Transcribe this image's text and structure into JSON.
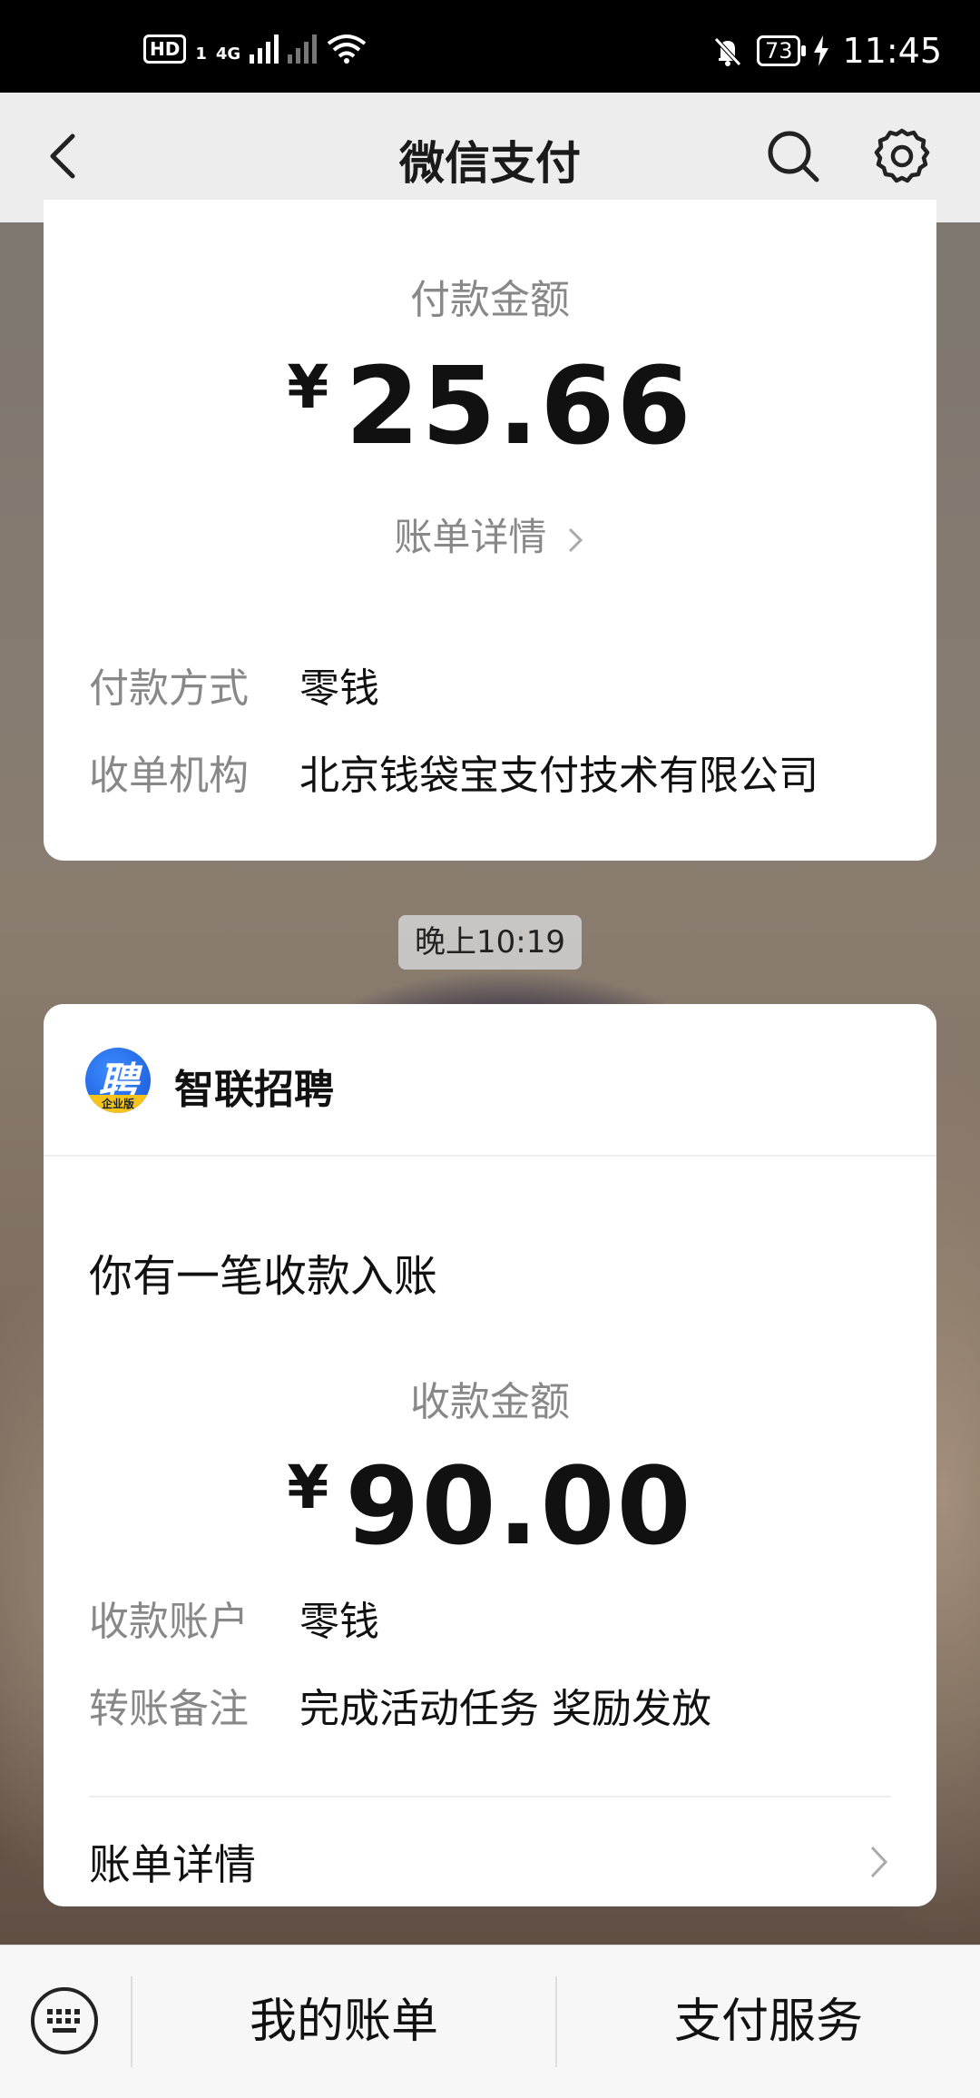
{
  "status_bar": {
    "hd": "HD",
    "sim": "1",
    "net": "4G",
    "battery": "73",
    "time": "11:45"
  },
  "header": {
    "title": "微信支付",
    "back_icon": "chevron-left-icon",
    "search_icon": "search-icon",
    "settings_icon": "gear-icon"
  },
  "payment_card": {
    "amount_label": "付款金额",
    "currency": "¥",
    "amount": "25.66",
    "detail_link": "账单详情",
    "rows": [
      {
        "key": "付款方式",
        "value": "零钱"
      },
      {
        "key": "收单机构",
        "value": "北京钱袋宝支付技术有限公司"
      }
    ]
  },
  "timestamp": "晚上10:19",
  "income_card": {
    "app_logo_char": "聘",
    "app_logo_band": "企业版",
    "app_name": "智联招聘",
    "notice": "你有一笔收款入账",
    "amount_label": "收款金额",
    "currency": "¥",
    "amount": "90.00",
    "rows": [
      {
        "key": "收款账户",
        "value": "零钱"
      },
      {
        "key": "转账备注",
        "value": "完成活动任务 奖励发放"
      }
    ],
    "bill_detail": "账单详情"
  },
  "bottom_bar": {
    "keyboard_icon": "keyboard-icon",
    "tabs": [
      "我的账单",
      "支付服务"
    ]
  },
  "colors": {
    "card_bg": "#ffffff",
    "label_grey": "#888888",
    "title_bar_bg": "#ededed",
    "status_bar_bg": "#000000"
  }
}
